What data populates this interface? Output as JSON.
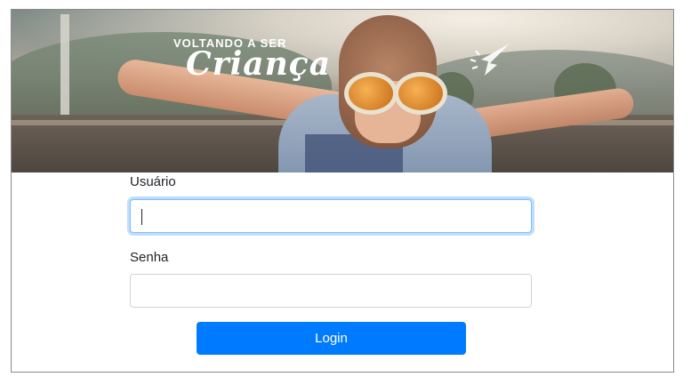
{
  "banner": {
    "title_small": "VOLTANDO A SER",
    "title_large": "Criança"
  },
  "form": {
    "username_label": "Usuário",
    "username_value": "",
    "password_label": "Senha",
    "password_value": "",
    "submit_label": "Login"
  },
  "colors": {
    "primary": "#007bff",
    "focus_border": "#80bdff",
    "input_border": "#ced4da"
  }
}
